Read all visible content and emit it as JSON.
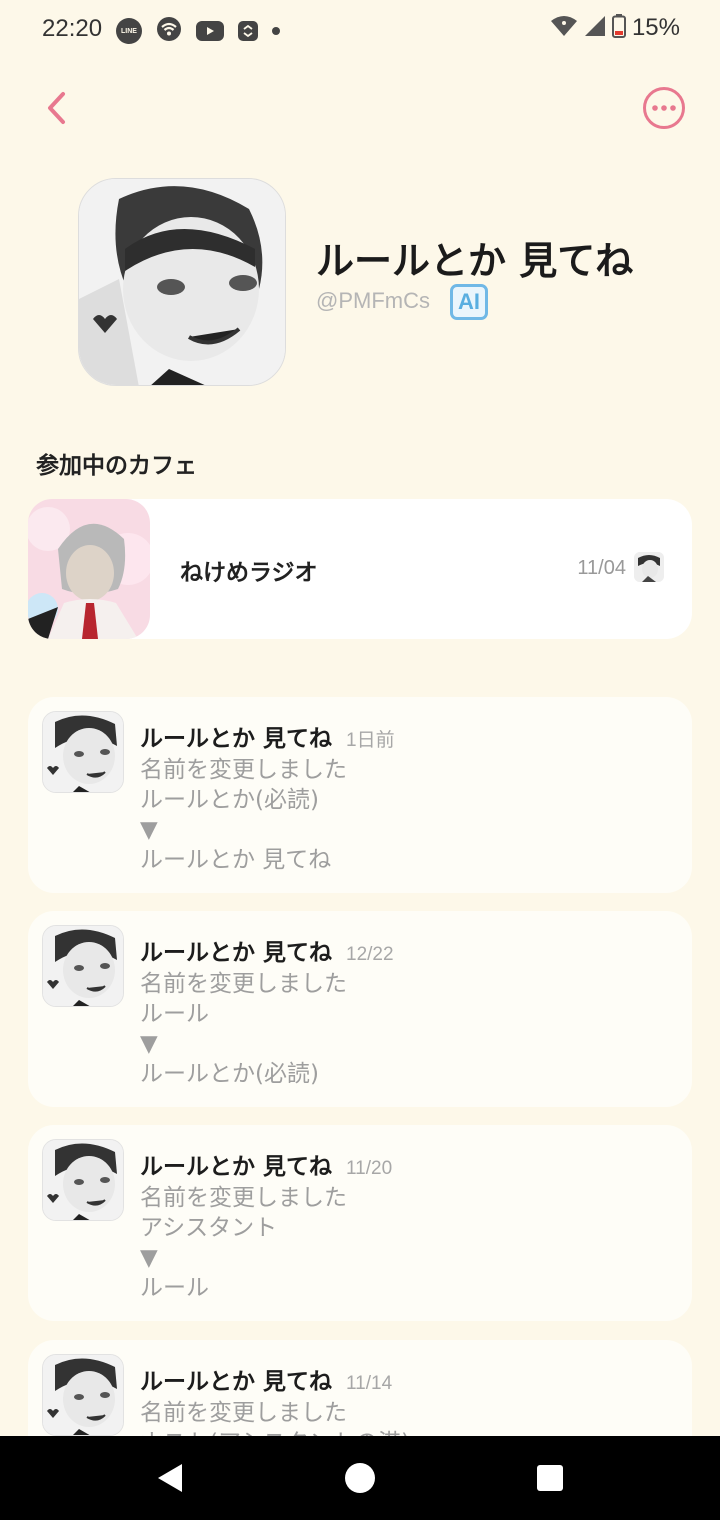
{
  "status_bar": {
    "time": "22:20",
    "battery": "15%",
    "notification_icons": [
      "line-icon",
      "wifi-hotspot-icon",
      "youtube-icon",
      "app-icon",
      "dot-icon"
    ]
  },
  "profile": {
    "name": "ルールとか 見てね",
    "handle": "@PMFmCs",
    "badge": "AI"
  },
  "section": {
    "title": "参加中のカフェ"
  },
  "cafe": {
    "name": "ねけめラジオ",
    "date": "11/04"
  },
  "activities": [
    {
      "name": "ルールとか 見てね",
      "time": "1日前",
      "lines": [
        "名前を変更しました",
        "ルールとか(必読)",
        "▼",
        "ルールとか 見てね"
      ]
    },
    {
      "name": "ルールとか 見てね",
      "time": "12/22",
      "lines": [
        "名前を変更しました",
        "ルール",
        "▼",
        "ルールとか(必読)"
      ]
    },
    {
      "name": "ルールとか 見てね",
      "time": "11/20",
      "lines": [
        "名前を変更しました",
        "アシスタント",
        "▼",
        "ルール"
      ]
    },
    {
      "name": "ルールとか 見てね",
      "time": "11/14",
      "lines": [
        "名前を変更しました",
        "ホスト(アシスタントの港)"
      ]
    }
  ],
  "colors": {
    "background": "#fdf8e9",
    "accent": "#e8788f",
    "ai_badge": "#5aaee0"
  }
}
